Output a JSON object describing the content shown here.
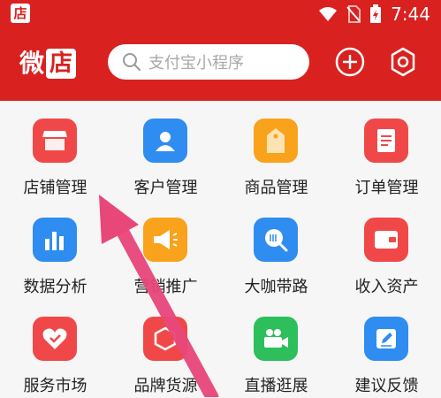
{
  "status_bar": {
    "app_icon_text": "店",
    "time": "7:44"
  },
  "header": {
    "logo_text_1": "微",
    "logo_text_2": "店",
    "search_placeholder": "支付宝小程序",
    "add_icon": "plus-circle-icon",
    "settings_icon": "gear-icon"
  },
  "grid": {
    "items": [
      {
        "label": "店铺管理",
        "icon": "store-icon",
        "color": "#f04848"
      },
      {
        "label": "客户管理",
        "icon": "person-icon",
        "color": "#2f8cf0"
      },
      {
        "label": "商品管理",
        "icon": "tag-icon",
        "color": "#f9a21b"
      },
      {
        "label": "订单管理",
        "icon": "document-icon",
        "color": "#f04848"
      },
      {
        "label": "数据分析",
        "icon": "bar-chart-icon",
        "color": "#2f8cf0"
      },
      {
        "label": "营销推广",
        "icon": "megaphone-icon",
        "color": "#f9a21b"
      },
      {
        "label": "大咖带路",
        "icon": "search-icon",
        "color": "#2f8cf0"
      },
      {
        "label": "收入资产",
        "icon": "wallet-icon",
        "color": "#f04848"
      },
      {
        "label": "服务市场",
        "icon": "heart-icon",
        "color": "#f04848"
      },
      {
        "label": "品牌货源",
        "icon": "badge-icon",
        "color": "#f04848"
      },
      {
        "label": "直播逛展",
        "icon": "video-camera-icon",
        "color": "#2cbf5c"
      },
      {
        "label": "建议反馈",
        "icon": "edit-icon",
        "color": "#2f8cf0"
      }
    ]
  },
  "colors": {
    "brand": "#d9211f",
    "arrow": "#e8477a"
  }
}
